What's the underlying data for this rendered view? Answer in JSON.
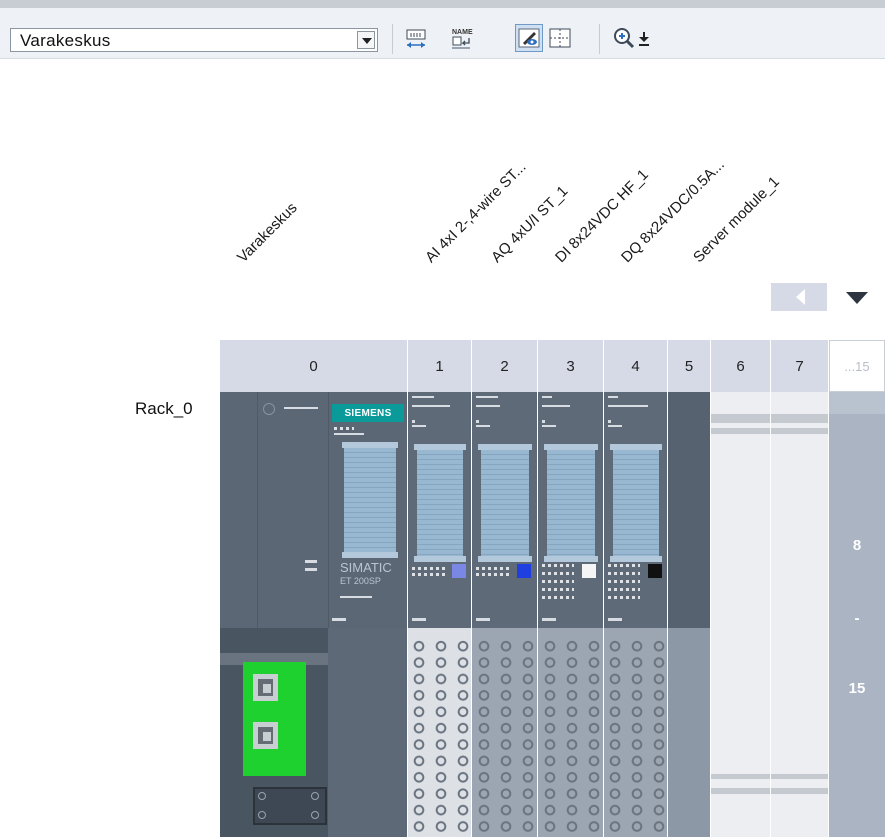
{
  "toolbar": {
    "device_select": {
      "value": "Varakeskus"
    },
    "buttons": [
      {
        "icon": "fit-width-icon"
      },
      {
        "icon": "show-names-icon",
        "label": "NAME"
      },
      {
        "icon": "show-module-labels-icon",
        "active": true
      },
      {
        "icon": "grid-view-icon"
      },
      {
        "icon": "zoom-in-icon"
      },
      {
        "icon": "zoom-dropdown-icon"
      }
    ]
  },
  "column_headers": [
    "Varakeskus",
    "AI 4xI 2-,4-wire ST...",
    "AQ 4xU/I ST_1",
    "DI 8x24VDC HF_1",
    "DQ 8x24VDC/0.5A...",
    "Server module_1"
  ],
  "slot_headers": [
    "0",
    "1",
    "2",
    "3",
    "4",
    "5",
    "6",
    "7",
    "...15"
  ],
  "rack": {
    "label": "Rack_0",
    "head_module": {
      "brand": "SIEMENS",
      "name": "SIMATIC",
      "model": "ET 200SP"
    },
    "overflow_range": {
      "from": "8",
      "separator": "-",
      "to": "15"
    },
    "module_colors": [
      "#7b87e4",
      "#1f3fe0",
      "#f5f5f5",
      "#111111"
    ]
  },
  "colors": {
    "accent_green": "#1fd12f",
    "header_bg": "#d5dae6",
    "module_dark": "#5e6a78",
    "overflow_bg": "#aab4c3"
  }
}
